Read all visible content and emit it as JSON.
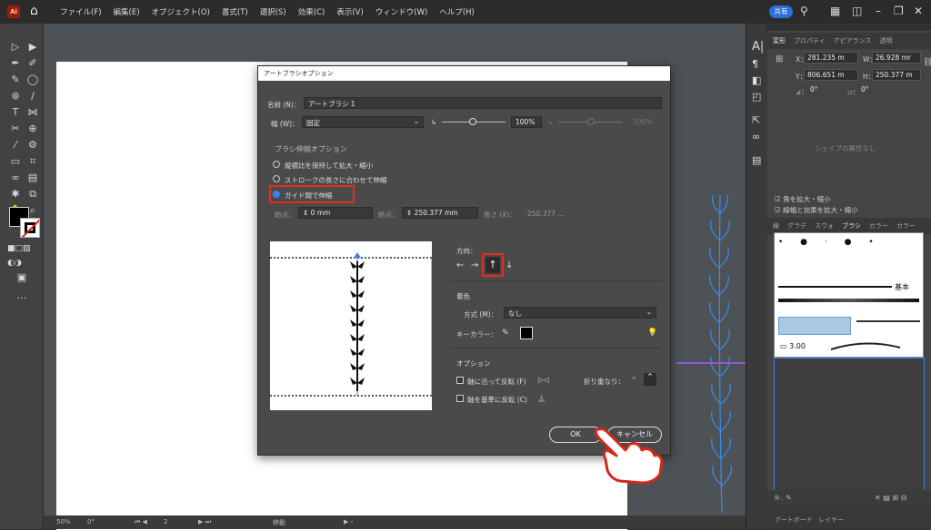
{
  "menubar": {
    "logo": "Ai",
    "menus": [
      "ファイル(F)",
      "編集(E)",
      "オブジェクト(O)",
      "書式(T)",
      "選択(S)",
      "効果(C)",
      "表示(V)",
      "ウィンドウ(W)",
      "ヘルプ(H)"
    ],
    "share": "共有"
  },
  "dialog": {
    "title": "アートブラシオプション",
    "name_label": "名前 (N)：",
    "name_value": "アートブラシ 1",
    "width_label": "幅 (W)：",
    "width_mode": "固定",
    "width_percent": "100%",
    "width_percent2": "100%",
    "scale_heading": "ブラシ伸縮オプション",
    "opt1": "縦横比を保持して拡大・縮小",
    "opt2": "ストロークの長さに合わせて伸縮",
    "opt3": "ガイド間で伸縮",
    "start_label": "始点：",
    "start_value": "0 mm",
    "end_label": "終点：",
    "end_value": "250.377 mm",
    "length_label": "長さ (X)：",
    "length_value": "250.377 ...",
    "direction_label": "方向：",
    "color_label": "着色",
    "method_label": "方式 (M)：",
    "method_value": "なし",
    "keycolor_label": "キーカラー：",
    "options_label": "オプション",
    "flip_along": "軸に沿って反転 (F)",
    "flip_across": "軸を基準に反転 (C)",
    "overlap_label": "折り重なり：",
    "ok": "OK",
    "cancel": "キャンセル"
  },
  "panel": {
    "tabs1": [
      "変形",
      "プロパティ",
      "アピアランス",
      "透明"
    ],
    "x_label": "X：",
    "x_value": "281.235 m",
    "w_label": "W：",
    "w_value": "26.928 mr",
    "y_label": "Y：",
    "y_value": "806.651 m",
    "h_label": "H：",
    "h_value": "250.377 m",
    "angle": "0°",
    "shear": "0°",
    "no_shape": "シェイプの属性なし",
    "check1": "角を拡大・縮小",
    "check2": "線幅と効果を拡大・縮小",
    "tabs2": [
      "線",
      "グラデ",
      "スウォ",
      "ブラシ",
      "カラー",
      "カラー"
    ],
    "basic": "基本",
    "stroke_size": "3.00",
    "tabs3": [
      "アートボード",
      "レイヤー"
    ]
  },
  "status": {
    "zoom": "50%",
    "angle": "0°",
    "page": "2",
    "mode": "移動"
  },
  "colors": {
    "highlight": "#e0301e",
    "accent": "#3c7ff0"
  }
}
